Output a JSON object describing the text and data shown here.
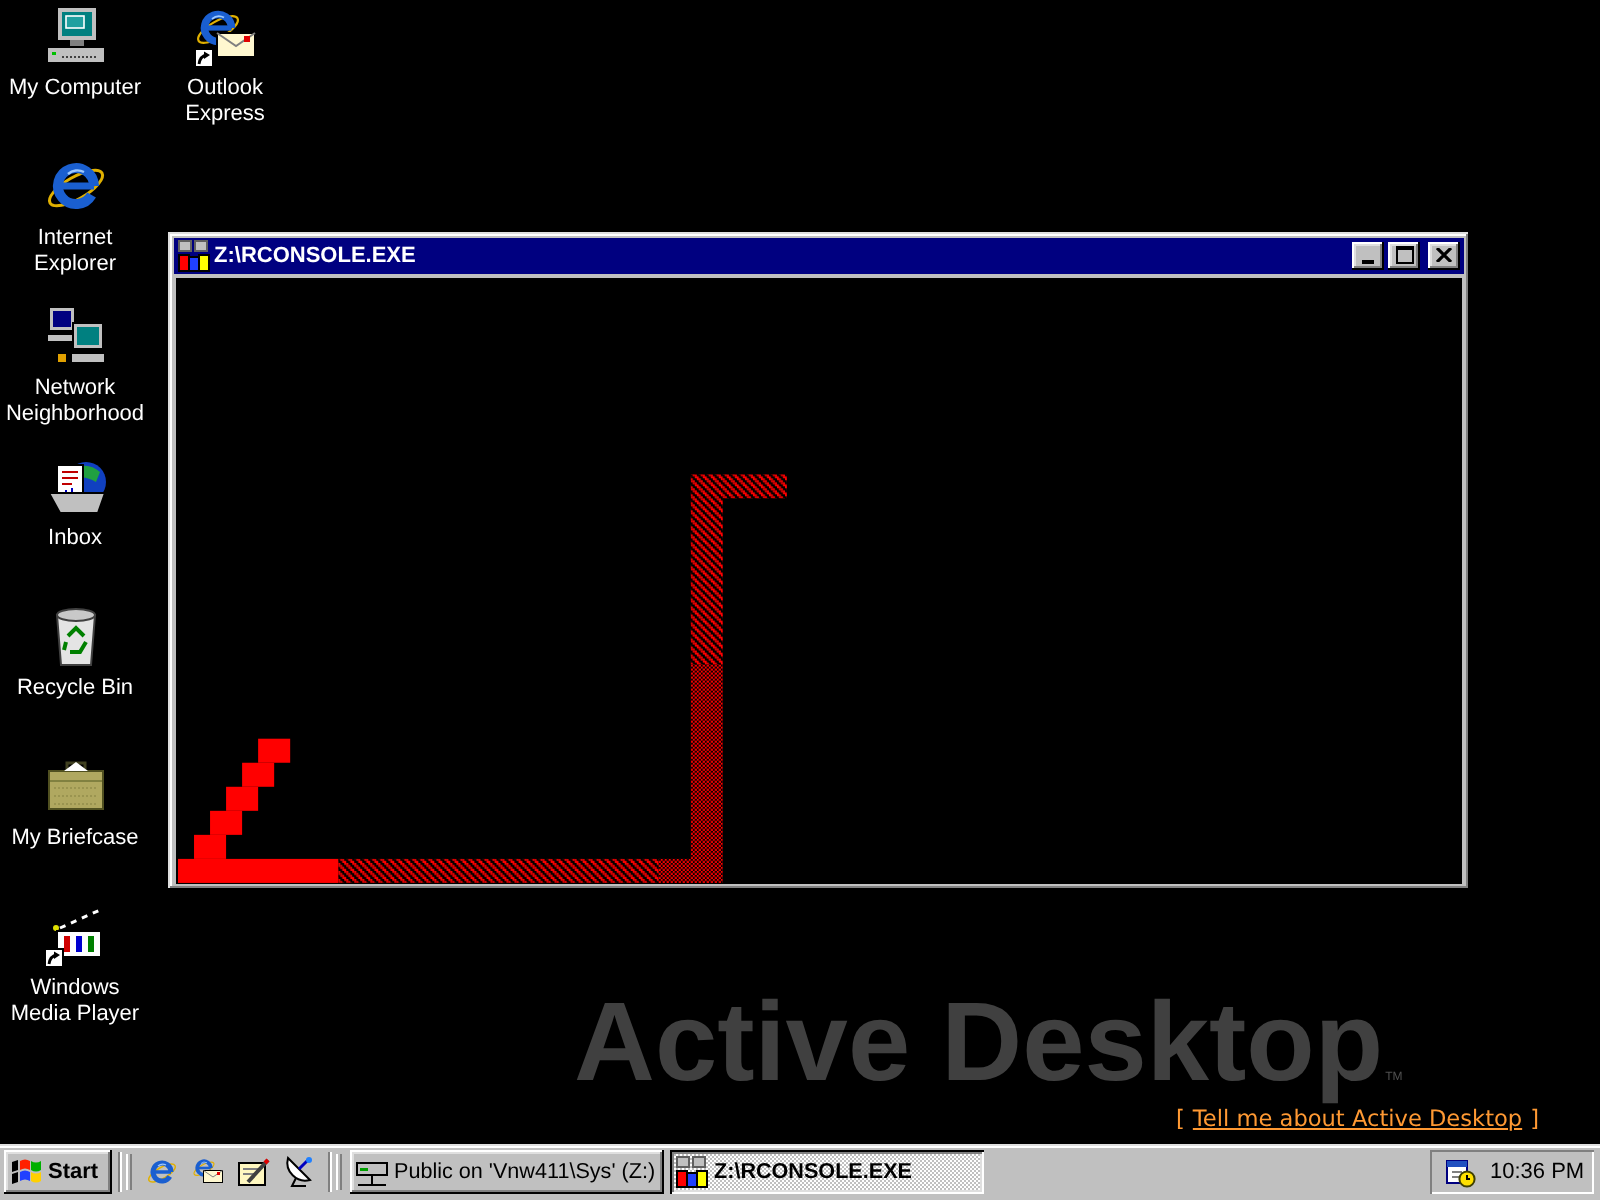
{
  "desktop_icons": [
    {
      "label": "My Computer",
      "kind": "computer",
      "shortcut": false
    },
    {
      "label": "Internet Explorer",
      "kind": "browser",
      "shortcut": false
    },
    {
      "label": "Network Neighborhood",
      "kind": "network",
      "shortcut": false
    },
    {
      "label": "Inbox",
      "kind": "inbox",
      "shortcut": false
    },
    {
      "label": "Recycle Bin",
      "kind": "bin",
      "shortcut": false
    },
    {
      "label": "My Briefcase",
      "kind": "briefcase",
      "shortcut": false
    },
    {
      "label": "Windows Media Player",
      "kind": "media",
      "shortcut": true
    },
    {
      "label": "Outlook Express",
      "kind": "mail",
      "shortcut": true
    }
  ],
  "window": {
    "title": "Z:\\RCONSOLE.EXE",
    "active": true
  },
  "branding": {
    "title": "Active Desktop",
    "trademark": "TM",
    "link": {
      "open_bracket": "[",
      "text": "Tell me about Active Desktop",
      "close_bracket": "]"
    }
  },
  "taskbar": {
    "start_button": "Start",
    "tasks": [
      {
        "label": "Public on 'Vnw411\\Sys' (Z:)",
        "kind": "drive",
        "selected": false
      },
      {
        "label": "Z:\\RCONSOLE.EXE",
        "kind": "dos",
        "selected": true
      }
    ],
    "clock": "10:36 PM"
  }
}
